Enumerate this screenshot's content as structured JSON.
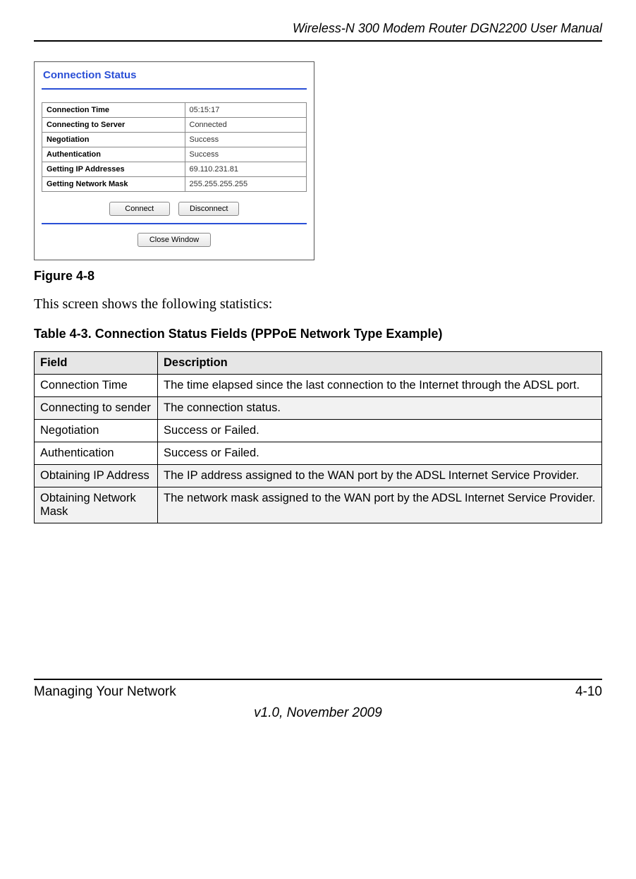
{
  "header": {
    "doc_title": "Wireless-N 300 Modem Router DGN2200 User Manual"
  },
  "screenshot": {
    "title": "Connection Status",
    "rows": [
      {
        "label": "Connection Time",
        "value": "05:15:17"
      },
      {
        "label": "Connecting to Server",
        "value": "Connected"
      },
      {
        "label": "Negotiation",
        "value": "Success"
      },
      {
        "label": "Authentication",
        "value": "Success"
      },
      {
        "label": "Getting IP Addresses",
        "value": "69.110.231.81"
      },
      {
        "label": "Getting Network Mask",
        "value": "255.255.255.255"
      }
    ],
    "buttons": {
      "connect": "Connect",
      "disconnect": "Disconnect",
      "close": "Close Window"
    }
  },
  "figure_label": "Figure 4-8",
  "intro_text": "This screen shows the following statistics:",
  "table_caption": "Table 4-3.  Connection Status Fields (PPPoE Network Type Example)",
  "desc_table": {
    "head_field": "Field",
    "head_desc": "Description",
    "rows": [
      {
        "field": "Connection Time",
        "desc": "The time elapsed since the last connection to the Internet through the ADSL port."
      },
      {
        "field": "Connecting to sender",
        "desc": "The connection status."
      },
      {
        "field": "Negotiation",
        "desc": "Success or Failed."
      },
      {
        "field": "Authentication",
        "desc": "Success or Failed."
      },
      {
        "field": "Obtaining IP Address",
        "desc": "The IP address assigned to the WAN port by the ADSL Internet Service Provider."
      },
      {
        "field": "Obtaining Network Mask",
        "desc": "The network mask assigned to the WAN port by the ADSL Internet Service Provider."
      }
    ]
  },
  "footer": {
    "left": "Managing Your Network",
    "right": "4-10",
    "center": "v1.0, November 2009"
  }
}
